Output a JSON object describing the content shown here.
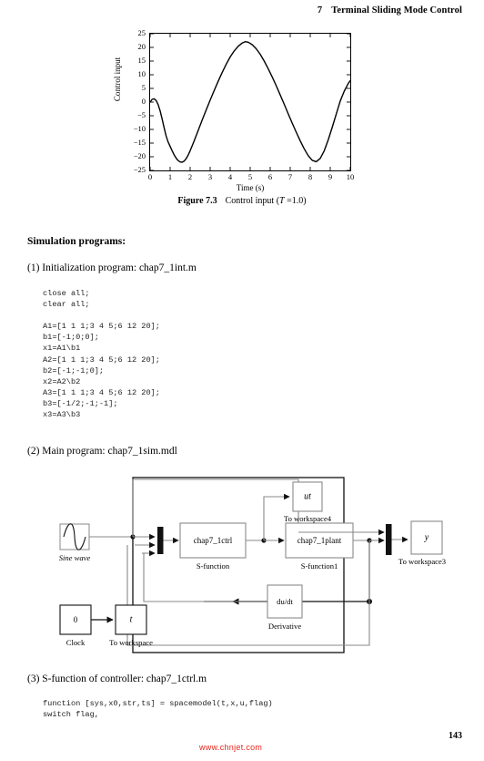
{
  "running_head": {
    "chapter_number": "7",
    "chapter_title": "Terminal Sliding Mode Control"
  },
  "figure": {
    "caption_label": "Figure 7.3",
    "caption_text": "Control input (",
    "caption_param": "T",
    "caption_value": " =1.0)"
  },
  "chart_data": {
    "type": "line",
    "title": "",
    "xlabel": "Time (s)",
    "ylabel": "Control input",
    "xlim": [
      0,
      10
    ],
    "ylim": [
      -25,
      25
    ],
    "xticks": [
      0,
      1,
      2,
      3,
      4,
      5,
      6,
      7,
      8,
      9,
      10
    ],
    "yticks": [
      -25,
      -20,
      -15,
      -10,
      -5,
      0,
      5,
      10,
      15,
      20,
      25
    ],
    "xtick_labels": [
      "0",
      "1",
      "2",
      "3",
      "4",
      "5",
      "6",
      "7",
      "8",
      "9",
      "10"
    ],
    "ytick_labels": [
      "-25",
      "-20",
      "-15",
      "-10",
      "-5",
      "0",
      "5",
      "10",
      "15",
      "20",
      "25"
    ],
    "grid": false,
    "legend": false,
    "series": [
      {
        "name": "Control input",
        "color": "#000000",
        "x": [
          0.0,
          0.1,
          0.2,
          0.3,
          0.4,
          0.5,
          0.6,
          0.7,
          0.8,
          0.9,
          1.0,
          1.1,
          1.2,
          1.3,
          1.4,
          1.5,
          1.6,
          1.7,
          1.8,
          1.9,
          2.0,
          2.2,
          2.4,
          2.6,
          2.8,
          3.0,
          3.2,
          3.4,
          3.6,
          3.8,
          4.0,
          4.2,
          4.4,
          4.6,
          4.75,
          4.9,
          5.1,
          5.3,
          5.5,
          5.7,
          5.9,
          6.1,
          6.3,
          6.5,
          6.7,
          6.9,
          7.1,
          7.3,
          7.5,
          7.7,
          7.9,
          8.1,
          8.3,
          8.5,
          8.7,
          8.9,
          9.1,
          9.3,
          9.5,
          9.7,
          9.9,
          10.0
        ],
        "y": [
          0.0,
          1.0,
          1.2,
          0.6,
          -0.9,
          -3.2,
          -6.2,
          -9.4,
          -12.4,
          -14.6,
          -16.2,
          -17.8,
          -19.3,
          -20.5,
          -21.4,
          -21.9,
          -22.0,
          -21.6,
          -20.7,
          -19.4,
          -17.8,
          -14.2,
          -10.4,
          -6.6,
          -2.9,
          0.7,
          4.2,
          7.6,
          10.8,
          13.8,
          16.5,
          18.7,
          20.4,
          21.6,
          22.1,
          21.9,
          21.0,
          19.5,
          17.5,
          15.0,
          12.2,
          9.2,
          6.0,
          2.6,
          -0.8,
          -4.3,
          -7.7,
          -11.0,
          -14.2,
          -17.1,
          -19.6,
          -21.3,
          -21.8,
          -20.6,
          -17.8,
          -13.8,
          -9.2,
          -4.4,
          0.4,
          4.0,
          6.8,
          7.8
        ]
      }
    ]
  },
  "sections": {
    "simulation_programs_heading": "Simulation programs:",
    "item1": "(1) Initialization program: chap7_1int.m",
    "item2": "(2) Main program: chap7_1sim.mdl",
    "item3": "(3) S-function of controller: chap7_1ctrl.m"
  },
  "code_init": "close all;\nclear all;\n\nA1=[1 1 1;3 4 5;6 12 20];\nb1=[-1;0;0];\nx1=A1\\b1\nA2=[1 1 1;3 4 5;6 12 20];\nb2=[-1;-1;0];\nx2=A2\\b2\nA3=[1 1 1;3 4 5;6 12 20];\nb3=[-1/2;-1;-1];\nx3=A3\\b3",
  "code_sfunction": "function [sys,x0,str,ts] = spacemodel(t,x,u,flag)\nswitch flag,",
  "diagram": {
    "sine_wave_label": "Sine wave",
    "mux_in_label": "",
    "ctrl_block_text": "chap7_1ctrl",
    "ctrl_block_label": "S-function",
    "plant_block_text": "chap7_1plant",
    "plant_block_label": "S-function1",
    "ut_block_text": "ut",
    "ut_block_label": "To workspace4",
    "y_block_text": "y",
    "y_block_label": "To workspace3",
    "derivative_block_text": "du/dt",
    "derivative_block_label": "Derivative",
    "clock_block_text": "0",
    "clock_block_label": "Clock",
    "t_block_text": "t",
    "t_block_label": "To workspace"
  },
  "footer": {
    "page_number": "143",
    "watermark": "www.chnjet.com"
  }
}
